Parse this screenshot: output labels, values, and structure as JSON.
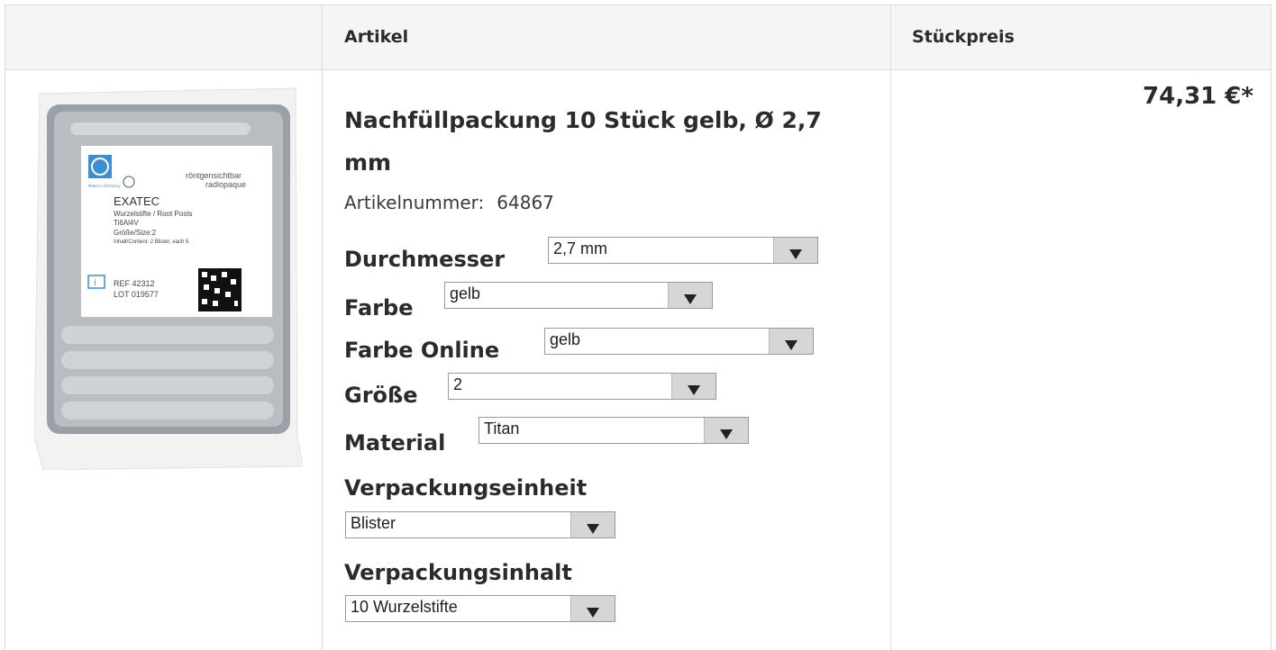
{
  "table": {
    "col_article": "Artikel",
    "col_price": "Stückpreis"
  },
  "product": {
    "title": "Nachfüllpackung 10 Stück gelb, Ø 2,7 mm",
    "article_number_label": "Artikelnummer:",
    "article_number": "64867",
    "price": "74,31 €*",
    "image": {
      "brand": "HAHNENKRATT",
      "made_in": "Made in Germany",
      "radiopaque_1": "röntgensichtbar",
      "radiopaque_2": "radiopaque",
      "name": "EXATEC",
      "desc": "Wurzelstifte / Root Posts",
      "alloy": "Ti6Al4V",
      "size": "Größe/Size:2",
      "content": "Inhalt/Content: 2 Blister, each 5",
      "ref": "REF 42312",
      "lot": "LOT 019577",
      "ce": "CE 0197"
    }
  },
  "options": {
    "durchmesser": {
      "label": "Durchmesser",
      "value": "2,7 mm"
    },
    "farbe": {
      "label": "Farbe",
      "value": "gelb"
    },
    "farbe_online": {
      "label": "Farbe Online",
      "value": "gelb"
    },
    "groesse": {
      "label": "Größe",
      "value": "2"
    },
    "material": {
      "label": "Material",
      "value": "Titan"
    },
    "verpackungseinheit": {
      "label": "Verpackungseinheit",
      "value": "Blister"
    },
    "verpackungsinhalt": {
      "label": "Verpackungsinhalt",
      "value": "10 Wurzelstifte"
    }
  },
  "icons": {
    "select_arrow": "triangle-down-icon",
    "info": "info-book-icon",
    "radiopaque": "circle-x-icon"
  },
  "colors": {
    "header_bg": "#f5f5f5",
    "border": "#dcdcdc",
    "select_button": "#d6d6d6",
    "label_blue": "#3b8fd0"
  }
}
